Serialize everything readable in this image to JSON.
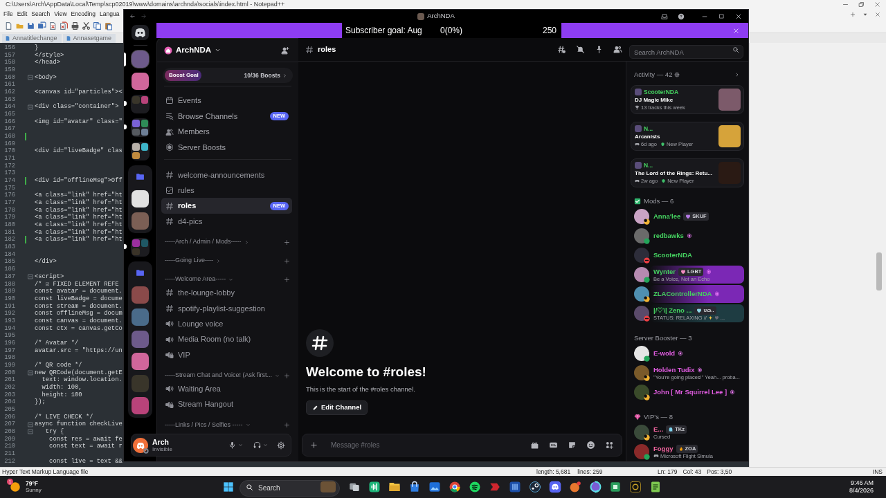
{
  "notepad": {
    "title": "C:\\Users\\Arch\\AppData\\Local\\Temp\\scp02019\\www\\domains\\archnda\\socials\\index.html - Notepad++",
    "menu": [
      "File",
      "Edit",
      "Search",
      "View",
      "Encoding",
      "Langua"
    ],
    "tabs": [
      {
        "label": "Annatitlechange",
        "selected": false
      },
      {
        "label": "Annasetgame",
        "selected": false
      }
    ],
    "lines": [
      {
        "number": "156",
        "text": "}",
        "fold": false,
        "changed": false
      },
      {
        "number": "157",
        "text": "</style>",
        "fold": false,
        "changed": false
      },
      {
        "number": "158",
        "text": "</head>",
        "fold": false,
        "changed": false
      },
      {
        "number": "159",
        "fold": false,
        "changed": false
      },
      {
        "number": "160",
        "text": "<body>",
        "fold": true,
        "changed": false
      },
      {
        "number": "161",
        "fold": false,
        "changed": false
      },
      {
        "number": "162",
        "text": "<canvas id=\"particles\"><",
        "fold": false,
        "changed": false
      },
      {
        "number": "163",
        "fold": false,
        "changed": false
      },
      {
        "number": "164",
        "text": "<div class=\"container\">",
        "fold": true,
        "changed": false
      },
      {
        "number": "165",
        "fold": false,
        "changed": false
      },
      {
        "number": "166",
        "text": "<img id=\"avatar\" class=\"",
        "fold": false,
        "changed": false
      },
      {
        "number": "167",
        "fold": false,
        "changed": false
      },
      {
        "number": "168",
        "fold": false,
        "changed": true
      },
      {
        "number": "169",
        "fold": false,
        "changed": false
      },
      {
        "number": "170",
        "text": "<div id=\"liveBadge\" clas",
        "fold": false,
        "changed": false
      },
      {
        "number": "171",
        "fold": false,
        "changed": false
      },
      {
        "number": "172",
        "fold": false,
        "changed": false
      },
      {
        "number": "173",
        "fold": false,
        "changed": false
      },
      {
        "number": "174",
        "text": "<div id=\"offlineMsg\">Off",
        "fold": false,
        "changed": true
      },
      {
        "number": "175",
        "fold": false,
        "changed": false
      },
      {
        "number": "176",
        "text": "<a class=\"link\" href=\"ht",
        "fold": false,
        "changed": false
      },
      {
        "number": "177",
        "text": "<a class=\"link\" href=\"ht",
        "fold": false,
        "changed": false
      },
      {
        "number": "178",
        "text": "<a class=\"link\" href=\"ht",
        "fold": false,
        "changed": false
      },
      {
        "number": "179",
        "text": "<a class=\"link\" href=\"ht",
        "fold": false,
        "changed": false
      },
      {
        "number": "180",
        "text": "<a class=\"link\" href=\"ht",
        "fold": false,
        "changed": false
      },
      {
        "number": "181",
        "text": "<a class=\"link\" href=\"ht",
        "fold": false,
        "changed": false
      },
      {
        "number": "182",
        "text": "<a class=\"link\" href=\"ht",
        "fold": false,
        "changed": true
      },
      {
        "number": "183",
        "fold": false,
        "changed": false
      },
      {
        "number": "184",
        "fold": false,
        "changed": false
      },
      {
        "number": "185",
        "text": "</div>",
        "fold": false,
        "changed": false
      },
      {
        "number": "186",
        "fold": false,
        "changed": false
      },
      {
        "number": "187",
        "text": "<script>",
        "fold": true,
        "changed": false
      },
      {
        "number": "188",
        "text": "/* ☑ FIXED ELEMENT REFE",
        "fold": false,
        "changed": false
      },
      {
        "number": "189",
        "text": "const avatar = document.",
        "fold": false,
        "changed": false
      },
      {
        "number": "190",
        "text": "const liveBadge = docume",
        "fold": false,
        "changed": false
      },
      {
        "number": "191",
        "text": "const stream = document.",
        "fold": false,
        "changed": false
      },
      {
        "number": "192",
        "text": "const offlineMsg = docum",
        "fold": false,
        "changed": false
      },
      {
        "number": "193",
        "text": "const canvas = document.",
        "fold": false,
        "changed": false
      },
      {
        "number": "194",
        "text": "const ctx = canvas.getCo",
        "fold": false,
        "changed": false
      },
      {
        "number": "195",
        "fold": false,
        "changed": false
      },
      {
        "number": "196",
        "text": "/* Avatar */",
        "fold": false,
        "changed": false
      },
      {
        "number": "197",
        "text": "avatar.src = \"https://un",
        "fold": false,
        "changed": false
      },
      {
        "number": "198",
        "fold": false,
        "changed": false
      },
      {
        "number": "199",
        "text": "/* QR code */",
        "fold": false,
        "changed": false
      },
      {
        "number": "200",
        "text": "new QRCode(document.getE",
        "fold": true,
        "changed": false
      },
      {
        "number": "201",
        "text": "  text: window.location.",
        "fold": false,
        "changed": false
      },
      {
        "number": "202",
        "text": "  width: 100,",
        "fold": false,
        "changed": false
      },
      {
        "number": "203",
        "text": "  height: 100",
        "fold": false,
        "changed": false
      },
      {
        "number": "204",
        "text": "});",
        "fold": false,
        "changed": false
      },
      {
        "number": "205",
        "fold": false,
        "changed": false
      },
      {
        "number": "206",
        "text": "/* LIVE CHECK */",
        "fold": false,
        "changed": false
      },
      {
        "number": "207",
        "text": "async function checkLive",
        "fold": true,
        "changed": false
      },
      {
        "number": "208",
        "text": "   try {",
        "fold": true,
        "changed": false
      },
      {
        "number": "209",
        "text": "    const res = await fe",
        "fold": false,
        "changed": false
      },
      {
        "number": "210",
        "text": "    const text = await r",
        "fold": false,
        "changed": false
      },
      {
        "number": "211",
        "fold": false,
        "changed": false
      },
      {
        "number": "212",
        "text": "    const live = text &&",
        "fold": false,
        "changed": false
      }
    ],
    "status_bar": {
      "file_type": "Hyper Text Markup Language file",
      "length": "length: 5,681",
      "lines": "lines: 259",
      "line": "Ln: 179",
      "column": "Col: 43",
      "position": "Pos: 3,50",
      "mode": "INS"
    }
  },
  "discord": {
    "title": "ArchNDA",
    "banner": {
      "label": "Subscriber goal: Aug",
      "count": "0(0%)",
      "target": "250"
    },
    "servers": [
      {
        "kind": "server",
        "selected": true,
        "unread": false
      },
      {
        "kind": "server",
        "selected": false,
        "unread": false
      },
      {
        "kind": "group",
        "selected": false,
        "unread": true,
        "children": [
          {
            "kind": "server"
          },
          {
            "kind": "server"
          }
        ]
      },
      {
        "kind": "group",
        "selected": false,
        "unread": true,
        "children": [
          {
            "kind": "server"
          },
          {
            "kind": "server"
          },
          {
            "kind": "server"
          },
          {
            "kind": "server"
          }
        ]
      },
      {
        "kind": "group",
        "selected": false,
        "unread": false,
        "children": [
          {
            "kind": "server"
          },
          {
            "kind": "server"
          },
          {
            "kind": "server"
          }
        ]
      },
      {
        "kind": "folder",
        "expanded": true,
        "children": [
          {
            "kind": "server",
            "selected": false,
            "unread": false
          },
          {
            "kind": "server",
            "selected": false,
            "unread": false
          }
        ]
      },
      {
        "kind": "group",
        "selected": false,
        "unread": true,
        "children": [
          {
            "kind": "server"
          },
          {
            "kind": "server"
          },
          {
            "kind": "server"
          }
        ]
      },
      {
        "kind": "folder",
        "expanded": true,
        "children": [
          {
            "kind": "server",
            "selected": false,
            "unread": false
          },
          {
            "kind": "server",
            "selected": false,
            "unread": false
          },
          {
            "kind": "server",
            "selected": false,
            "unread": false
          },
          {
            "kind": "server",
            "selected": false,
            "unread": false
          },
          {
            "kind": "server",
            "selected": false,
            "unread": false
          },
          {
            "kind": "server",
            "selected": false,
            "unread": false
          }
        ]
      }
    ],
    "server_name": "ArchNDA",
    "boost_goal": {
      "label": "Boost Goal",
      "progress": "10/36 Boosts",
      "level": 0.28
    },
    "shortcuts": [
      {
        "kind": "events",
        "label": "Events"
      },
      {
        "kind": "browse",
        "label": "Browse Channels",
        "badge": "NEW"
      },
      {
        "kind": "members",
        "label": "Members"
      },
      {
        "kind": "boosts",
        "label": "Server Boosts"
      }
    ],
    "channels": [
      {
        "kind": "text",
        "name": "welcome-announcements",
        "selected": false
      },
      {
        "kind": "rules",
        "name": "rules",
        "selected": false
      },
      {
        "kind": "text",
        "name": "roles",
        "selected": true,
        "badge": "NEW"
      },
      {
        "kind": "text",
        "name": "d4-pics",
        "selected": false
      },
      {
        "kind": "category",
        "name": "-----Arch / Admin / Mods-----",
        "expanded": false
      },
      {
        "kind": "category",
        "name": "-----Going Live----",
        "expanded": false
      },
      {
        "kind": "category",
        "name": "-----Welcome Area-----",
        "expanded": true,
        "children": [
          {
            "kind": "text",
            "name": "the-lounge-lobby",
            "selected": false
          },
          {
            "kind": "text",
            "name": "spotify-playlist-suggestion",
            "selected": false
          },
          {
            "kind": "voice",
            "name": "Lounge voice",
            "selected": false
          },
          {
            "kind": "voice",
            "name": "Media Room (no talk)",
            "selected": false
          },
          {
            "kind": "locked_voice",
            "name": "VIP",
            "selected": false
          }
        ]
      },
      {
        "kind": "category",
        "name": "-----Stream Chat and Voice! (Ask first...",
        "expanded": true,
        "children": [
          {
            "kind": "voice",
            "name": "Waiting Area",
            "selected": false
          },
          {
            "kind": "locked_voice",
            "name": "Stream Hangout",
            "selected": false
          }
        ]
      },
      {
        "kind": "category",
        "name": "-----Links / Pics / Selfies -----",
        "expanded": true
      }
    ],
    "user": {
      "name": "Arch",
      "status": "Invisible",
      "status_dot": {
        "kind": "invisible",
        "color": "#80848e"
      }
    },
    "header": {
      "channel": "roles",
      "search_placeholder": "Search ArchNDA"
    },
    "welcome": {
      "title": "Welcome to #roles!",
      "text": "This is the start of the #roles channel.",
      "button": "Edit Channel"
    },
    "composer": {
      "placeholder": "Message #roles"
    },
    "activity": {
      "title": "Activity — 42",
      "cards": [
        {
          "user": "ScooterNDA",
          "title": "DJ Magic Mike",
          "details": [
            {
              "kind": "trophy",
              "text": "13 tracks this week"
            }
          ]
        },
        {
          "user": "N...",
          "title": "Arcanists",
          "details": [
            {
              "kind": "game",
              "text": "6d ago"
            },
            {
              "kind": "badge",
              "text": "New Player"
            }
          ]
        },
        {
          "user": "N...",
          "title": "The Lord of the Rings: Retu...",
          "details": [
            {
              "kind": "game",
              "text": "2w ago"
            },
            {
              "kind": "badge",
              "text": "New Player"
            }
          ]
        }
      ]
    },
    "member_groups": [
      {
        "kind": "checked",
        "title": "Mods — 6",
        "members": [
          {
            "name": "Anna'lee",
            "color": "#45d160",
            "status": {
              "kind": "idle",
              "color": "#f0b232"
            },
            "booster": false,
            "tag": {
              "kind": "heart",
              "color": "#b67be6",
              "text": "SKUF"
            }
          },
          {
            "name": "redbawks",
            "color": "#45d160",
            "status": {
              "kind": "online",
              "color": "#23a55a"
            },
            "booster": true
          },
          {
            "name": "ScooterNDA",
            "color": "#45d160",
            "status": {
              "kind": "dnd",
              "color": "#f23f43"
            },
            "booster": false
          },
          {
            "name": "Wynter",
            "color": "#45d160",
            "status": {
              "kind": "online",
              "color": "#23a55a"
            },
            "booster": true,
            "tag": {
              "kind": "heart",
              "color": "#f28bc0",
              "text": "LGBT"
            },
            "subtitle": {
              "kind": "custom",
              "text": "Be a Voice, Not an Echo"
            },
            "nameplate": {
              "color": "#7b28b5"
            }
          },
          {
            "name": "ZLAControllerNDA",
            "color": "#45d160",
            "status": {
              "kind": "idle",
              "color": "#f0b232"
            },
            "booster": true,
            "nameplate": {
              "color": "#7b28b5"
            }
          },
          {
            "name": "|/♡\\| Zeno ...",
            "color": "#45d160",
            "status": {
              "kind": "dnd",
              "color": "#f23f43"
            },
            "booster": false,
            "tag": {
              "kind": "heart",
              "color": "#8fd8e8",
              "text": "ʊɷ.."
            },
            "subtitle": {
              "kind": "custom",
              "text": "STATUS: RELAXING //",
              "emoji": [
                {
                  "kind": "sparkle"
                },
                {
                  "kind": "heart"
                }
              ],
              "suffix": "..."
            },
            "nameplate": {
              "color": "#1e3c42"
            }
          }
        ]
      },
      {
        "kind": "plain",
        "title": "Server Booster — 3",
        "members": [
          {
            "name": "E-wold",
            "color": "#e05ce0",
            "status": {
              "kind": "online",
              "color": "#23a55a"
            },
            "booster": true
          },
          {
            "name": "Holden Tudix",
            "color": "#e05ce0",
            "status": {
              "kind": "idle",
              "color": "#f0b232"
            },
            "booster": true,
            "subtitle": {
              "kind": "custom",
              "text": "\"You're going places!\" Yeah... proba..."
            }
          },
          {
            "name": "John [ Mr Squirrel Lee ]",
            "color": "#e05ce0",
            "status": {
              "kind": "idle",
              "color": "#f0b232"
            },
            "booster": true
          }
        ]
      },
      {
        "kind": "gem",
        "title": "VIP's — 8",
        "members": [
          {
            "name": "E...",
            "color": "#f0649e",
            "status": {
              "kind": "idle",
              "color": "#f0b232"
            },
            "booster": false,
            "tag": {
              "kind": "ghost",
              "color": "#7fd3ee",
              "text": "TKz"
            },
            "subtitle": {
              "kind": "custom",
              "text": "Cursed"
            }
          },
          {
            "name": "Foggy",
            "color": "#f0649e",
            "status": {
              "kind": "online",
              "color": "#23a55a"
            },
            "booster": false,
            "tag": {
              "kind": "flame",
              "color": "#f59e0b",
              "text": "ZOA"
            },
            "subtitle": {
              "kind": "game",
              "text": "Microsoft Flight Simula"
            }
          }
        ]
      }
    ]
  },
  "taskbar": {
    "weather": {
      "badge": "1",
      "temperature": "79°F",
      "condition": "Sunny"
    },
    "search_placeholder": "Search",
    "time": "9:46 AM",
    "date": "8/4/2026"
  }
}
